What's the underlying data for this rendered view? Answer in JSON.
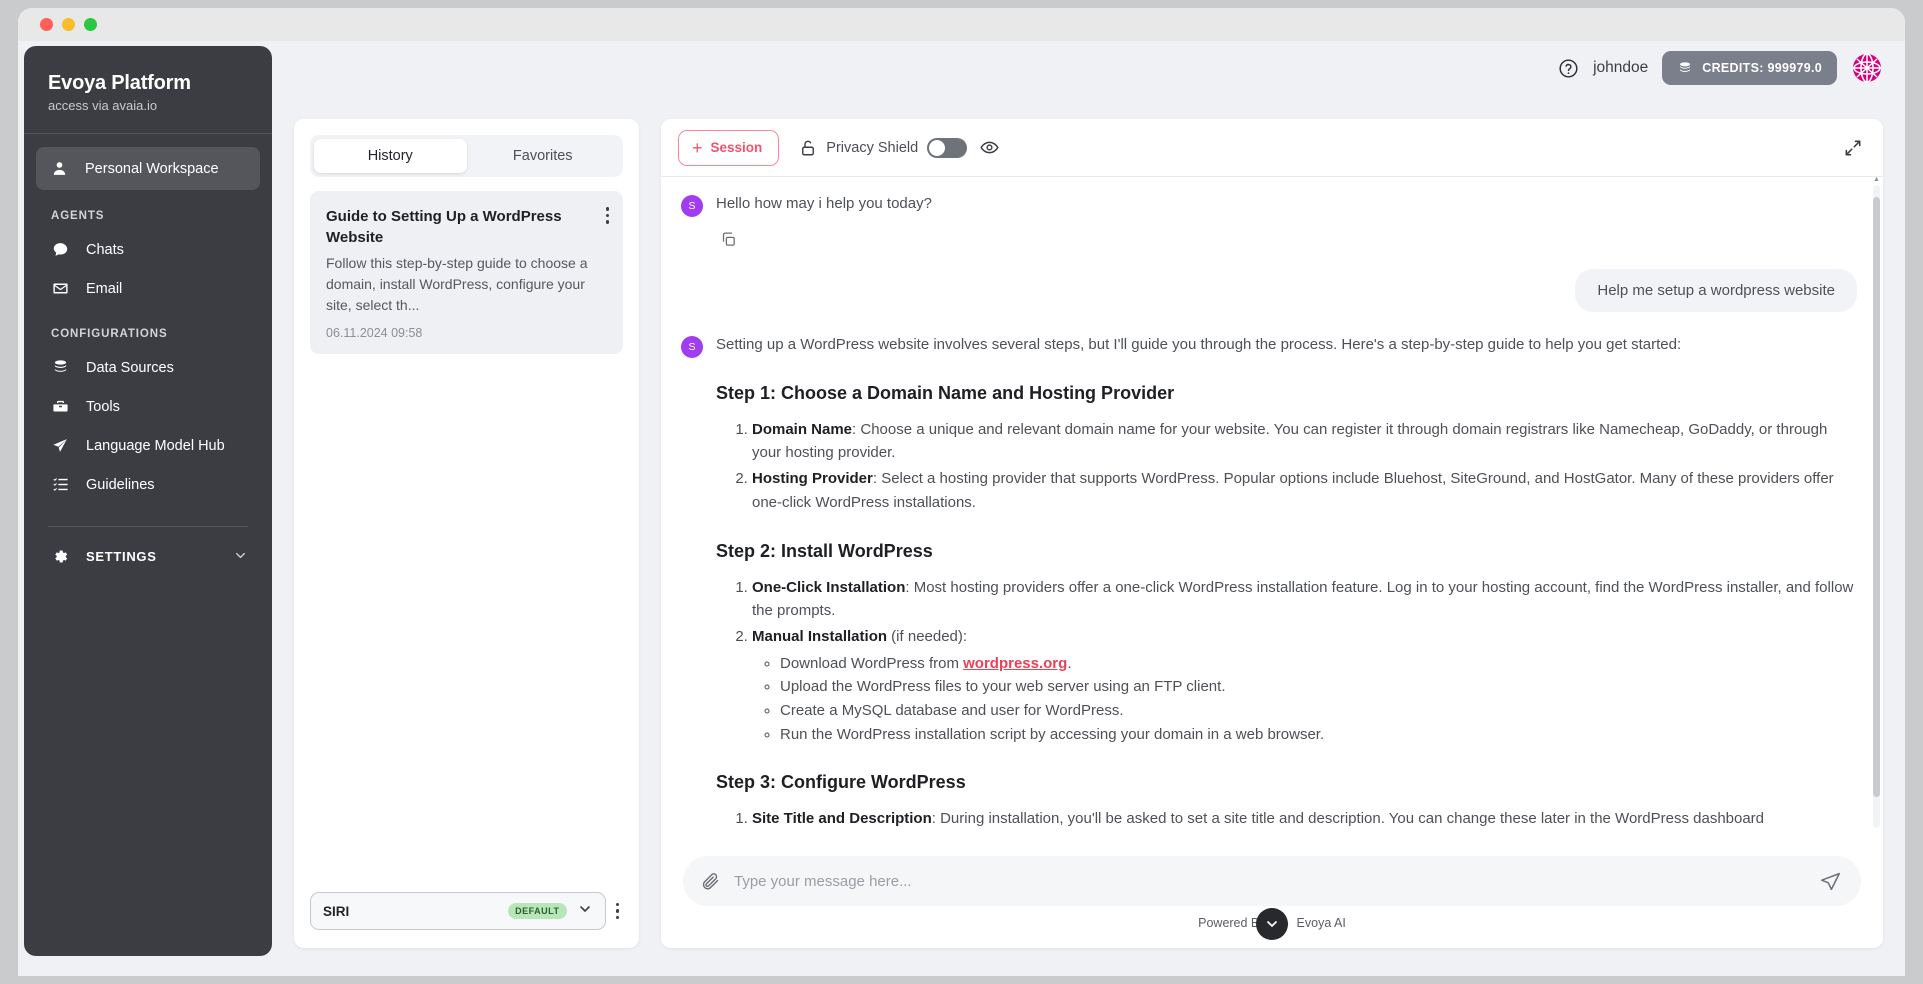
{
  "window": {
    "traffic_lights": [
      "close",
      "minimize",
      "maximize"
    ]
  },
  "topbar": {
    "help_icon": "question-circle-icon",
    "username": "johndoe",
    "credits_label": "CREDITS: 999979.0",
    "coin_icon": "coins-icon",
    "avatar_icon": "globe-logo-icon",
    "credits_bg": "#7b7f8c"
  },
  "sidebar": {
    "brand_title": "Evoya Platform",
    "brand_subtitle": "access via avaia.io",
    "workspace": {
      "label": "Personal Workspace",
      "icon": "user-icon"
    },
    "sections": [
      {
        "title": "AGENTS",
        "items": [
          {
            "label": "Chats",
            "icon": "chat-bubble-icon"
          },
          {
            "label": "Email",
            "icon": "envelope-icon"
          }
        ]
      },
      {
        "title": "CONFIGURATIONS",
        "items": [
          {
            "label": "Data Sources",
            "icon": "database-icon"
          },
          {
            "label": "Tools",
            "icon": "toolbox-icon"
          },
          {
            "label": "Language Model Hub",
            "icon": "paper-plane-icon"
          },
          {
            "label": "Guidelines",
            "icon": "checklist-icon"
          }
        ]
      }
    ],
    "settings": {
      "label": "SETTINGS",
      "icon": "gear-icon",
      "chevron": "chevron-down-icon"
    },
    "bg": "#3b3d42"
  },
  "history_panel": {
    "tabs": [
      {
        "label": "History",
        "active": true
      },
      {
        "label": "Favorites",
        "active": false
      }
    ],
    "cards": [
      {
        "title": "Guide to Setting Up a WordPress Website",
        "description": "Follow this step-by-step guide to choose a domain, install WordPress, configure your site, select th...",
        "date": "06.11.2024 09:58",
        "menu_icon": "kebab-menu-icon"
      }
    ],
    "agent_selector": {
      "name": "SIRI",
      "badge": "DEFAULT",
      "chevron": "chevron-down-icon",
      "menu_icon": "kebab-menu-icon",
      "badge_bg": "#b8e6b8"
    }
  },
  "chat": {
    "toolbar": {
      "session_label": "Session",
      "session_plus": "+",
      "session_color": "#f0536e",
      "privacy_shield_label": "Privacy Shield",
      "lock_icon": "lock-icon",
      "toggle_state": "off",
      "eye_icon": "eye-icon",
      "expand_icon": "expand-arrows-icon"
    },
    "messages": [
      {
        "role": "assistant",
        "avatar_letter": "S",
        "text": "Hello how may i help you today?",
        "copy_icon": "copy-icon"
      },
      {
        "role": "user",
        "text": "Help me setup a wordpress website"
      }
    ],
    "response": {
      "avatar_letter": "S",
      "intro": "Setting up a WordPress website involves several steps, but I'll guide you through the process. Here's a step-by-step guide to help you get started:",
      "sections": [
        {
          "heading": "Step 1: Choose a Domain Name and Hosting Provider",
          "items": [
            {
              "bold": "Domain Name",
              "rest": ": Choose a unique and relevant domain name for your website. You can register it through domain registrars like Namecheap, GoDaddy, or through your hosting provider."
            },
            {
              "bold": "Hosting Provider",
              "rest": ": Select a hosting provider that supports WordPress. Popular options include Bluehost, SiteGround, and HostGator. Many of these providers offer one-click WordPress installations."
            }
          ]
        },
        {
          "heading": "Step 2: Install WordPress",
          "items": [
            {
              "bold": "One-Click Installation",
              "rest": ": Most hosting providers offer a one-click WordPress installation feature. Log in to your hosting account, find the WordPress installer, and follow the prompts."
            },
            {
              "bold": "Manual Installation",
              "rest": " (if needed):",
              "sub": [
                {
                  "pre": "Download WordPress from ",
                  "link": "wordpress.org",
                  "post": "."
                },
                {
                  "pre": "Upload the WordPress files to your web server using an FTP client.",
                  "link": "",
                  "post": ""
                },
                {
                  "pre": "Create a MySQL database and user for WordPress.",
                  "link": "",
                  "post": ""
                },
                {
                  "pre": "Run the WordPress installation script by accessing your domain in a web browser.",
                  "link": "",
                  "post": ""
                }
              ]
            }
          ]
        },
        {
          "heading": "Step 3: Configure WordPress",
          "items": [
            {
              "bold": "Site Title and Description",
              "rest": ": During installation, you'll be asked to set a site title and description. You can change these later in the WordPress dashboard"
            }
          ]
        }
      ]
    },
    "scroll_down_icon": "chevron-down-icon",
    "composer": {
      "placeholder": "Type your message here...",
      "value": "",
      "attach_icon": "paperclip-icon",
      "send_icon": "send-icon"
    },
    "footer": {
      "powered_by": "Powered By",
      "brand": "Evoya AI",
      "logo_icon": "evoya-logo-icon"
    }
  }
}
